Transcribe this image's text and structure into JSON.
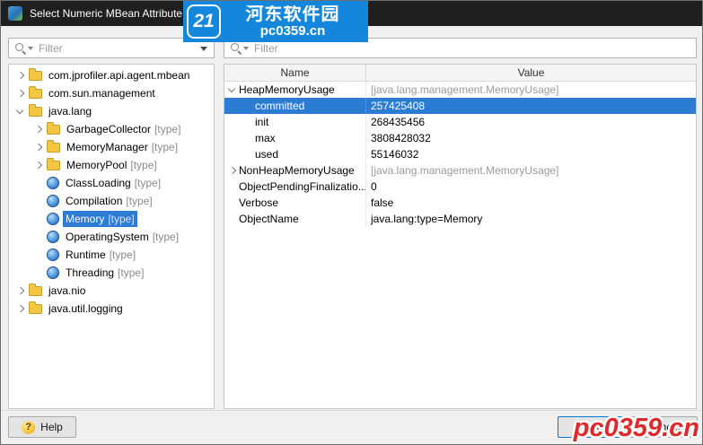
{
  "window": {
    "title": "Select Numeric MBean Attribute"
  },
  "left_panel": {
    "filter": {
      "placeholder": "Filter"
    },
    "tree": {
      "items": [
        {
          "label": "com.jprofiler.api.agent.mbean",
          "icon": "folder",
          "state": "collapsed"
        },
        {
          "label": "com.sun.management",
          "icon": "folder",
          "state": "collapsed"
        },
        {
          "label": "java.lang",
          "icon": "folder",
          "state": "expanded"
        },
        {
          "label": "GarbageCollector",
          "suffix": "[type]",
          "icon": "folder",
          "state": "collapsed"
        },
        {
          "label": "MemoryManager",
          "suffix": "[type]",
          "icon": "folder",
          "state": "collapsed"
        },
        {
          "label": "MemoryPool",
          "suffix": "[type]",
          "icon": "folder",
          "state": "collapsed"
        },
        {
          "label": "ClassLoading",
          "suffix": "[type]",
          "icon": "mbean"
        },
        {
          "label": "Compilation",
          "suffix": "[type]",
          "icon": "mbean"
        },
        {
          "label": "Memory",
          "suffix": "[type]",
          "icon": "mbean",
          "selected": true
        },
        {
          "label": "OperatingSystem",
          "suffix": "[type]",
          "icon": "mbean"
        },
        {
          "label": "Runtime",
          "suffix": "[type]",
          "icon": "mbean"
        },
        {
          "label": "Threading",
          "suffix": "[type]",
          "icon": "mbean"
        },
        {
          "label": "java.nio",
          "icon": "folder",
          "state": "collapsed"
        },
        {
          "label": "java.util.logging",
          "icon": "folder",
          "state": "collapsed"
        }
      ]
    }
  },
  "right_panel": {
    "filter": {
      "placeholder": "Filter"
    },
    "table": {
      "columns": [
        "Name",
        "Value"
      ],
      "rows": [
        {
          "name": "HeapMemoryUsage",
          "value": "[java.lang.management.MemoryUsage]",
          "state": "expanded",
          "value_muted": true
        },
        {
          "name": "committed",
          "value": "257425408",
          "child": true,
          "selected": true
        },
        {
          "name": "init",
          "value": "268435456",
          "child": true
        },
        {
          "name": "max",
          "value": "3808428032",
          "child": true
        },
        {
          "name": "used",
          "value": "55146032",
          "child": true
        },
        {
          "name": "NonHeapMemoryUsage",
          "value": "[java.lang.management.MemoryUsage]",
          "state": "collapsed",
          "value_muted": true
        },
        {
          "name": "ObjectPendingFinalizatio...",
          "value": "0"
        },
        {
          "name": "Verbose",
          "value": "false"
        },
        {
          "name": "ObjectName",
          "value": "java.lang:type=Memory"
        }
      ]
    }
  },
  "footer": {
    "help_label": "Help",
    "ok_label": "OK",
    "cancel_label": "Cancel",
    "help_icon_glyph": "?"
  },
  "watermark": {
    "logo_text": "21",
    "site_name": "河东软件园",
    "site_url": "pc0359.cn",
    "bottom_url": "pc0359.cn"
  },
  "colors": {
    "selection_blue": "#2d7cd4",
    "accent_blue": "#0078d7",
    "watermark_blue": "#1487dc",
    "watermark_red": "#dd2b2b",
    "titlebar": "#1f1f1f"
  }
}
